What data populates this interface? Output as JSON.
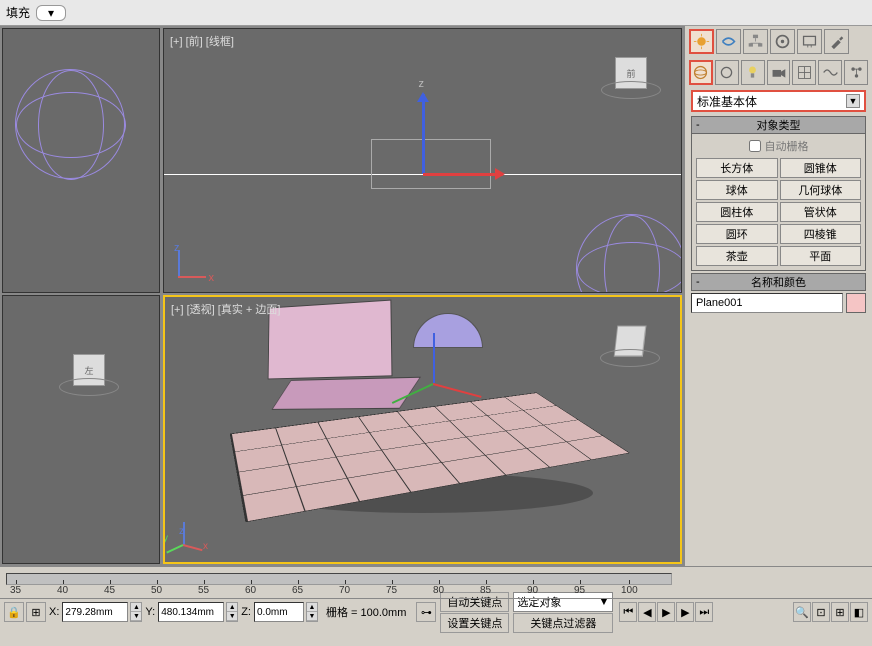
{
  "topbar": {
    "fill_label": "填充",
    "dropdown_glyph": "▾"
  },
  "viewports": {
    "top_right_label": "[+] [前] [线框]",
    "bot_right_label": "[+] [透视] [真实 + 边面]",
    "axes": {
      "x": "x",
      "y": "y",
      "z": "z"
    }
  },
  "panel": {
    "category": "标准基本体",
    "object_type_header": "对象类型",
    "auto_grid": "自动栅格",
    "buttons": [
      "长方体",
      "圆锥体",
      "球体",
      "几何球体",
      "圆柱体",
      "管状体",
      "圆环",
      "四棱锥",
      "茶壶",
      "平面"
    ],
    "name_color_header": "名称和颜色",
    "object_name": "Plane001"
  },
  "timeline": {
    "ticks": [
      "35",
      "40",
      "45",
      "50",
      "55",
      "60",
      "65",
      "70",
      "75",
      "80",
      "85",
      "90",
      "95",
      "100"
    ]
  },
  "status": {
    "x_label": "X:",
    "x_val": "279.28mm",
    "y_label": "Y:",
    "y_val": "480.134mm",
    "z_label": "Z:",
    "z_val": "0.0mm",
    "grid_label": "栅格 = 100.0mm",
    "auto_key": "自动关键点",
    "set_key": "设置关键点",
    "filter": "选定对象",
    "key_filter": "关键点过滤器"
  }
}
